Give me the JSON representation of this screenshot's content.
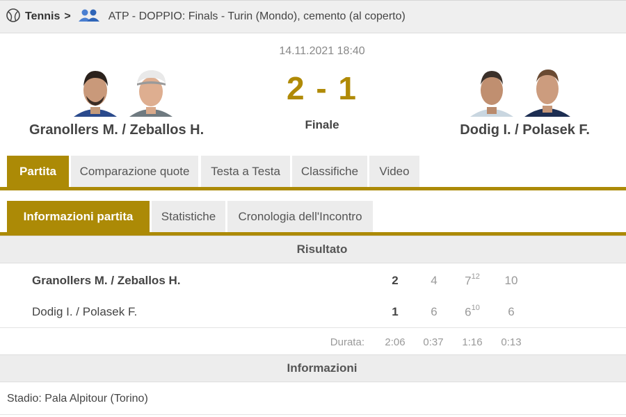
{
  "breadcrumb": {
    "sport": "Tennis",
    "separator": ">",
    "tournament": "ATP - DOPPIO: Finals - Turin (Mondo), cemento (al coperto)"
  },
  "match": {
    "datetime": "14.11.2021 18:40",
    "score": "2 - 1",
    "status": "Finale",
    "home_team": "Granollers M. / Zeballos H.",
    "away_team": "Dodig I. / Polasek F."
  },
  "tabs_main": [
    "Partita",
    "Comparazione quote",
    "Testa a Testa",
    "Classifiche",
    "Video"
  ],
  "tabs_sub": [
    "Informazioni partita",
    "Statistiche",
    "Cronologia dell'Incontro"
  ],
  "result": {
    "title": "Risultato",
    "rows": [
      {
        "name": "Granollers M. / Zeballos H.",
        "total": "2",
        "sets": [
          "4",
          "7",
          "10"
        ],
        "tiebreak": "12"
      },
      {
        "name": "Dodig I. / Polasek F.",
        "total": "1",
        "sets": [
          "6",
          "6",
          "6"
        ],
        "tiebreak": "10"
      }
    ],
    "duration_label": "Durata:",
    "durations": [
      "2:06",
      "0:37",
      "1:16",
      "0:13"
    ]
  },
  "info": {
    "title": "Informazioni",
    "stadium": "Stadio: Pala Alpitour (Torino)"
  },
  "colors": {
    "accent": "#ac8a06",
    "score": "#b08a06"
  }
}
